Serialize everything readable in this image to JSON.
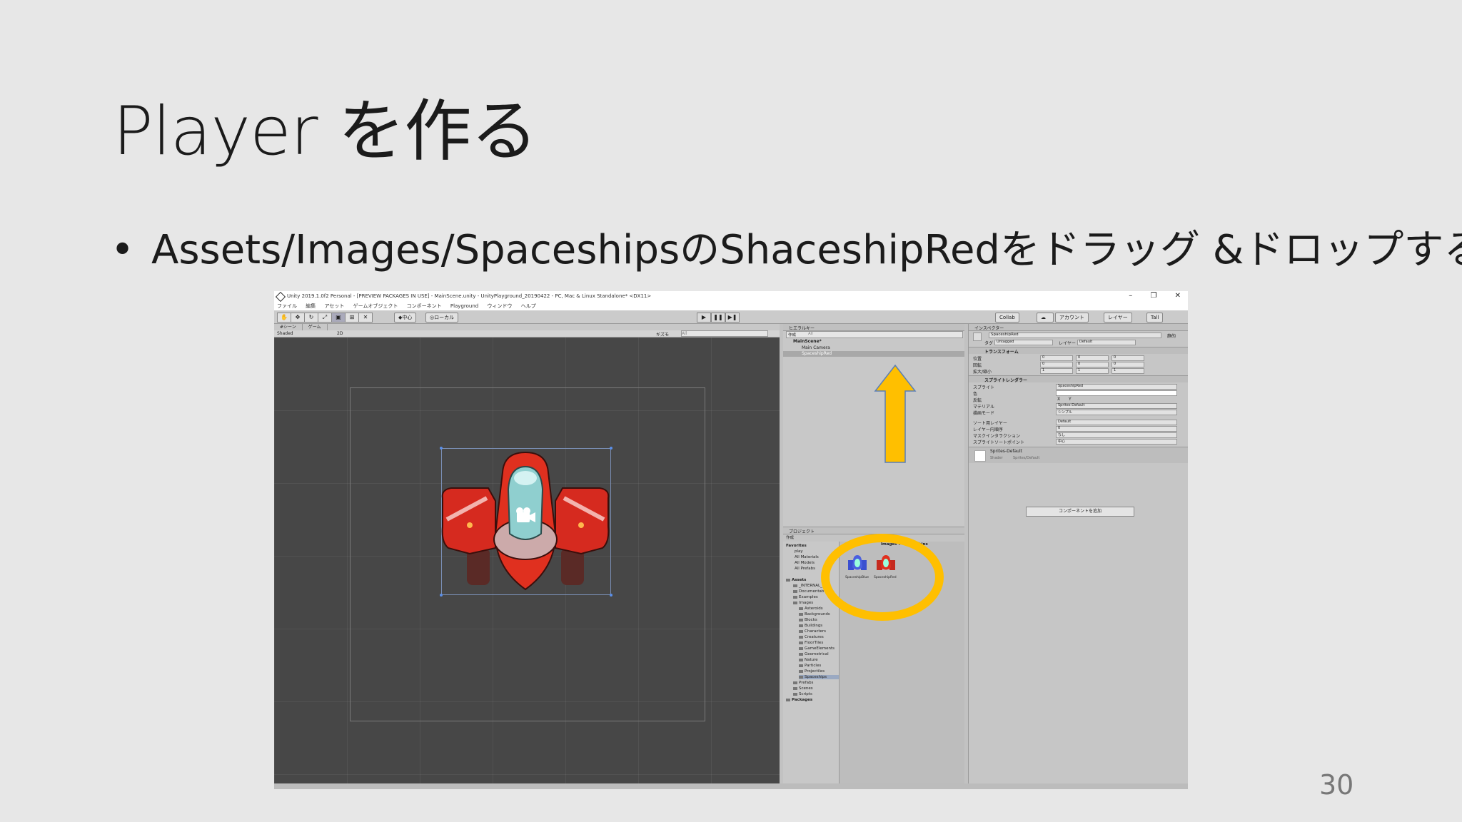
{
  "slide": {
    "title": "Player を作る",
    "bullet": "Assets/Images/SpaceshipsのShaceshipRedをドラッグ &ドロップする",
    "page_number": "30"
  },
  "editor": {
    "window_title": "Unity 2019.1.0f2 Personal - [PREVIEW PACKAGES IN USE] - MainScene.unity - UnityPlayground_20190422 - PC, Mac & Linux Standalone* <DX11>",
    "window_controls": [
      "–",
      "❐",
      "✕"
    ],
    "menu": [
      "ファイル",
      "編集",
      "アセット",
      "ゲームオブジェクト",
      "コンポーネント",
      "Playground",
      "ウィンドウ",
      "ヘルプ"
    ],
    "toolbar": {
      "pivot": "◆中心",
      "local": "◎ローカル",
      "collab": "Collab",
      "account": "アカウント",
      "layers": "レイヤー",
      "layout": "Tall"
    },
    "scene": {
      "tabs": [
        "#シーン",
        "ゲーム"
      ],
      "shading_mode": "Shaded",
      "mode_2d": "2D",
      "gizmos": "ギズモ",
      "search_placeholder": "All"
    },
    "hierarchy": {
      "tab": "ヒエラルキー",
      "create": "作成",
      "search_placeholder": "All",
      "scene_name": "MainScene*",
      "items": [
        "Main Camera",
        "SpaceshipRed"
      ]
    },
    "project": {
      "tab": "プロジェクト",
      "create": "作成",
      "breadcrumb": "Images > Spaceships",
      "favorites_label": "Favorites",
      "favorites": [
        "play",
        "All Materials",
        "All Models",
        "All Prefabs"
      ],
      "assets_label": "Assets",
      "tree": [
        "_INTERNAL_",
        "Documentation",
        "Examples",
        "Images"
      ],
      "image_folders": [
        "Asteroids",
        "Backgrounds",
        "Blocks",
        "Buildings",
        "Characters",
        "Creatures",
        "FloorTiles",
        "GameElements",
        "Geometrical",
        "Nature",
        "Particles",
        "Projectiles",
        "Spaceships"
      ],
      "after": [
        "Prefabs",
        "Scenes",
        "Scripts"
      ],
      "packages_label": "Packages",
      "assets_shown": [
        "SpaceshipBlue",
        "SpaceshipRed"
      ]
    },
    "inspector": {
      "tab": "インスペクター",
      "object_name": "SpaceshipRed",
      "static_label": "静的",
      "tag_label": "タグ",
      "tag_value": "Untagged",
      "layer_label": "レイヤー",
      "layer_value": "Default",
      "transform_title": "トランスフォーム",
      "position_label": "位置",
      "rotation_label": "回転",
      "scale_label": "拡大/縮小",
      "position": [
        "0",
        "0",
        "0"
      ],
      "rotation": [
        "0",
        "0",
        "0"
      ],
      "scale": [
        "1",
        "1",
        "1"
      ],
      "sprite_renderer_title": "スプライトレンダラー",
      "sprite_label": "スプライト",
      "sprite_value": "SpaceshipRed",
      "color_label": "色",
      "flip_label": "反転",
      "flip_x": "X",
      "flip_y": "Y",
      "material_label": "マテリアル",
      "material_value": "Sprites-Default",
      "draw_mode_label": "描画モード",
      "draw_mode_value": "シンプル",
      "sorting_layer_label": "ソート用レイヤー",
      "sorting_layer_value": "Default",
      "order_label": "レイヤー内順序",
      "order_value": "0",
      "mask_label": "マスクインタラクション",
      "mask_value": "なし",
      "sort_point_label": "スプライトソートポイント",
      "sort_point_value": "中心",
      "material_asset": "Sprites-Default",
      "shader_label": "Shader",
      "shader_value": "Sprites/Default",
      "add_component": "コンポーネントを追加"
    }
  },
  "colors": {
    "slide_bg": "#e7e7e7",
    "scene_bg": "#474747",
    "annotation": "#ffbf00",
    "ship_red": "#d62a1f",
    "selection_handle": "#5b8fe8"
  }
}
